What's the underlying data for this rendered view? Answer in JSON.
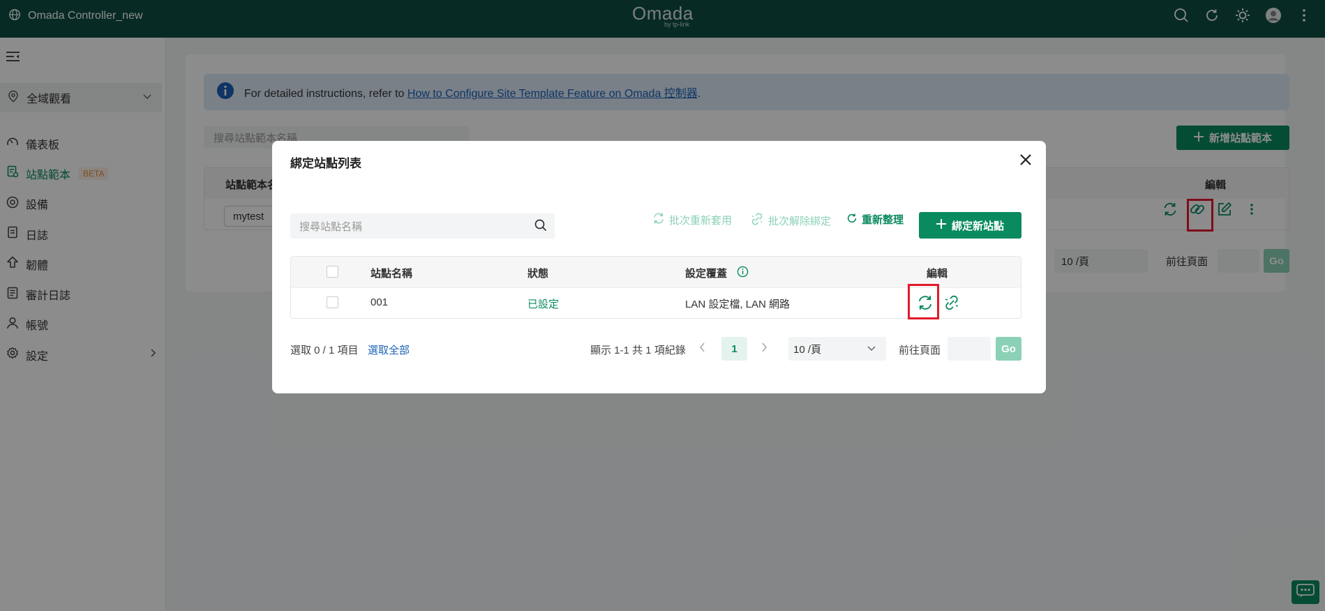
{
  "topbar": {
    "controller_name": "Omada Controller_new",
    "logo_main": "Omada",
    "logo_sub": "by tp-link",
    "icons": [
      "search-icon",
      "refresh-icon",
      "theme-icon",
      "avatar",
      "more-icon"
    ]
  },
  "sidebar": {
    "global_view": "全域觀看",
    "items": [
      {
        "label": "儀表板",
        "icon": "dashboard-icon"
      },
      {
        "label": "站點範本",
        "icon": "site-template-icon",
        "badge": "BETA",
        "active": true
      },
      {
        "label": "設備",
        "icon": "device-icon"
      },
      {
        "label": "日誌",
        "icon": "log-icon"
      },
      {
        "label": "韌體",
        "icon": "firmware-icon"
      },
      {
        "label": "審計日誌",
        "icon": "audit-log-icon"
      },
      {
        "label": "帳號",
        "icon": "account-icon"
      },
      {
        "label": "設定",
        "icon": "settings-icon"
      }
    ]
  },
  "page": {
    "info_text": "For detailed instructions, refer to",
    "info_link": "How to Configure Site Template Feature on Omada 控制器",
    "info_tail": ".",
    "search_placeholder": "搜尋站點範本名稱",
    "add_button": "新增站點範本",
    "table_col_name": "站點範本名",
    "table_col_edit": "編輯",
    "row_name": "mytest",
    "per_page": "10 /頁",
    "goto_label": "前往頁面",
    "go_button": "Go"
  },
  "modal": {
    "title": "綁定站點列表",
    "search_placeholder": "搜尋站點名稱",
    "batch_reapply": "批次重新套用",
    "batch_unbind": "批次解除綁定",
    "refresh": "重新整理",
    "bind_new": "綁定新站點",
    "columns": {
      "name": "站點名稱",
      "status": "狀態",
      "override": "設定覆蓋",
      "edit": "編輯"
    },
    "rows": [
      {
        "name": "001",
        "status": "已設定",
        "override": "LAN 設定檔, LAN 網路"
      }
    ],
    "selected_text": "選取 0 / 1 項目",
    "select_all": "選取全部",
    "total_text": "顯示 1-1 共 1 項紀錄",
    "current_page": "1",
    "per_page": "10 /頁",
    "goto_label": "前往頁面",
    "go_button": "Go"
  },
  "colors": {
    "brand": "#0a8a5f",
    "topbar": "#0d4f42",
    "highlight": "#e3192a",
    "link": "#1a62b5"
  }
}
